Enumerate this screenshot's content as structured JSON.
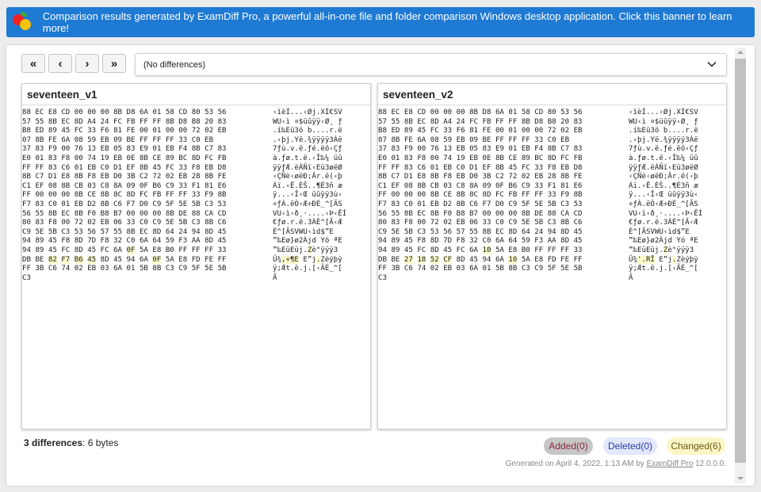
{
  "banner": {
    "text": "Comparison results generated by ExamDiff Pro, a powerful all-in-one file and folder comparison Windows desktop application. Click this banner to learn more!"
  },
  "toolbar": {
    "first_icon": "«",
    "prev_icon": "‹",
    "next_icon": "›",
    "last_icon": "»",
    "dropdown_value": "(No differences)"
  },
  "left": {
    "title": "seventeen_v1",
    "hex": [
      "88 EC E8 CD 00 00 00 8B D8 6A 01 58 CD 80 53 56",
      "57 55 8B EC 8D A4 24 FC FB FF FF 8B D8 B8 20 83",
      "B8 ED 89 45 FC 33 F6 81 FE 00 01 00 00 72 02 EB",
      "07 8B FE 6A 08 59 EB 09 BE FF FF FF 33 C0 EB",
      "37 83 F9 00 76 13 EB 05 83 E9 01 EB F4 8B C7 83",
      "E0 01 83 F8 00 74 19 EB 0E 8B CE 89 BC 8D FC FB",
      "FF FF 83 C6 01 EB C0 D1 EF 8B 45 FC 33 F8 EB D8",
      "8B C7 D1 E8 8B F8 EB D0 3B C2 72 02 EB 28 8B FE",
      "C1 EF 08 8B CB 03 C8 8A 09 0F B6 C9 33 F1 81 E6",
      "FF 00 00 00 8B CE 8B 8C 8D FC FB FF FF 33 F9 8B",
      "F7 83 C0 01 EB D2 8B C6 F7 D0 C9 5F 5E 5B C3 53",
      "56 55 8B EC 8B F0 B8 B7 00 00 00 8B DE 88 CA CD",
      "80 83 F8 00 72 02 EB 06 33 C0 C9 5E 5B C3 8B C6",
      "C9 5E 5B C3 53 56 57 55 8B EC 8D 64 24 94 8D 45",
      "94 89 45 F8 8D 7D F8 32 C0 6A 64 59 F3 AA 8D 45",
      "94 89 45 FC 8D 45 FC 6A 0F 5A E8 B0 FF FF FF 33",
      "DB BE 82 F7 B6 45 8D 45 94 6A 0F 5A E8 FD FE FF",
      "FF 3B C6 74 02 EB 03 6A 01 5B 8B C3 C9 5F 5E 5B",
      "C3"
    ],
    "ascii": [
      "‹ìèÍ...‹Øj.XÍ€SV",
      "WU‹ì ¤$üûÿÿ‹Ø¸ ƒ",
      ".í‰Eü3ö b....r.ë",
      ".‹þj.Yë.¾ÿÿÿÿ3Àë",
      "7ƒù.v.ë.ƒé.ëô‹Çƒ",
      "à.ƒø.t.ë.‹Î‰¼ üû",
      "ÿÿƒÆ.ëÀÑï‹Eü3øëØ",
      "‹ÇÑè‹øëÐ;Âr.ë(‹þ",
      "Áï.‹Ë.ÈŠ..¶É3ñ æ",
      "ÿ...‹Î‹Œ üûÿÿ3ù‹",
      "÷ƒÀ.ëÒ‹Æ÷ÐÉ_^[ÃS",
      "VU‹ì‹ð¸·....‹Þ‹ÊÍ",
      "€ƒø.r.ë.3ÀÉ^[Ã‹Æ",
      "É^[ÃSVWU‹ìd$”E",
      "”‰Eø}ø2Àjd Yó ªE",
      "”‰EüEüj.Zè°ÿÿÿ3",
      "Û¾‚÷¶E E”j.Zèýþÿ",
      "ÿ;Æt.ë.j.[‹ÃÉ_^[",
      "Ã"
    ]
  },
  "right": {
    "title": "seventeen_v2",
    "hex": [
      "88 EC E8 CD 00 00 00 8B D8 6A 01 58 CD 80 53 56",
      "57 55 8B EC 8D A4 24 FC FB FF FF 8B D8 B8 20 83",
      "B8 ED 89 45 FC 33 F6 81 FE 00 01 00 00 72 02 EB",
      "07 8B FE 6A 08 59 EB 09 BE FF FF FF 33 C0 EB",
      "37 83 F9 00 76 13 EB 05 83 E9 01 EB F4 8B C7 83",
      "E0 01 83 F8 00 74 19 EB 0E 8B CE 89 BC 8D FC FB",
      "FF FF 83 C6 01 EB C0 D1 EF 8B 45 FC 33 F8 EB D8",
      "8B C7 D1 E8 8B F8 EB D0 3B C2 72 02 EB 28 8B FE",
      "C1 EF 08 8B CB 03 C8 8A 09 0F B6 C9 33 F1 81 E6",
      "FF 00 00 00 8B CE 8B 8C 8D FC FB FF FF 33 F9 8B",
      "F7 83 C0 01 EB D2 8B C6 F7 D0 C9 5F 5E 5B C3 53",
      "56 55 8B EC 8B F0 B8 B7 00 00 00 8B DE 88 CA CD",
      "80 83 F8 00 72 02 EB 06 33 C0 C9 5E 5B C3 8B C6",
      "C9 5E 5B C3 53 56 57 55 8B EC 8D 64 24 94 8D 45",
      "94 89 45 F8 8D 7D F8 32 C0 6A 64 59 F3 AA 8D 45",
      "94 89 45 FC 8D 45 FC 6A 10 5A E8 B0 FF FF FF 33",
      "DB BE 27 18 52 CF 8D 45 94 6A 10 5A E8 FD FE FF",
      "FF 3B C6 74 02 EB 03 6A 01 5B 8B C3 C9 5F 5E 5B",
      "C3"
    ],
    "ascii": [
      "‹ìèÍ...‹Øj.XÍ€SV",
      "WU‹ì ¤$üûÿÿ‹Ø¸ ƒ",
      ".í‰Eü3ö b....r.ë",
      ".‹þj.Yë.¾ÿÿÿÿ3Àë",
      "7ƒù.v.ë.ƒé.ëô‹Çƒ",
      "à.ƒø.t.ë.‹Î‰¼ üû",
      "ÿÿƒÆ.ëÀÑï‹Eü3øëØ",
      "‹ÇÑè‹øëÐ;Âr.ë(‹þ",
      "Áï.‹Ë.ÈŠ..¶É3ñ æ",
      "ÿ...‹Î‹Œ üûÿÿ3ù‹",
      "÷ƒÀ.ëÒ‹Æ÷ÐÉ_^[ÃS",
      "VU‹ì‹ð¸·....‹Þ‹ÊÍ",
      "€ƒø.r.ë.3ÀÉ^[Ã‹Æ",
      "É^[ÃSVWU‹ìd$”E",
      "”‰Eø}ø2Àjd Yó ªE",
      "”‰EüEüj.Zè°ÿÿÿ3",
      "Û¾'.RÏ E”j.Zèýþÿ",
      "ÿ;Æt.ë.j.[‹ÃÉ_^[",
      "Ã"
    ]
  },
  "highlights": [
    {
      "row": 15,
      "hex_cols": [
        8
      ],
      "ascii_cols": [
        8
      ]
    },
    {
      "row": 16,
      "hex_cols": [
        2,
        3,
        4,
        5,
        10
      ],
      "ascii_cols": [
        2,
        3,
        4,
        5,
        10
      ]
    }
  ],
  "summary": {
    "count_label": "3 differences",
    "bytes_label": ": 6 bytes"
  },
  "badges": {
    "added": "Added(0)",
    "deleted": "Deleted(0)",
    "changed": "Changed(6)"
  },
  "footer": {
    "prefix": "Generated on April 4, 2022, 1:13 AM by ",
    "link": "ExamDiff Pro",
    "suffix": " 12.0.0.0."
  },
  "colors": {
    "banner": "#1e7ad3",
    "highlight": "#fafacb",
    "added_bg": "#c6c6c6",
    "deleted_bg": "#e2e7fb",
    "changed_bg": "#fbf6c6"
  }
}
